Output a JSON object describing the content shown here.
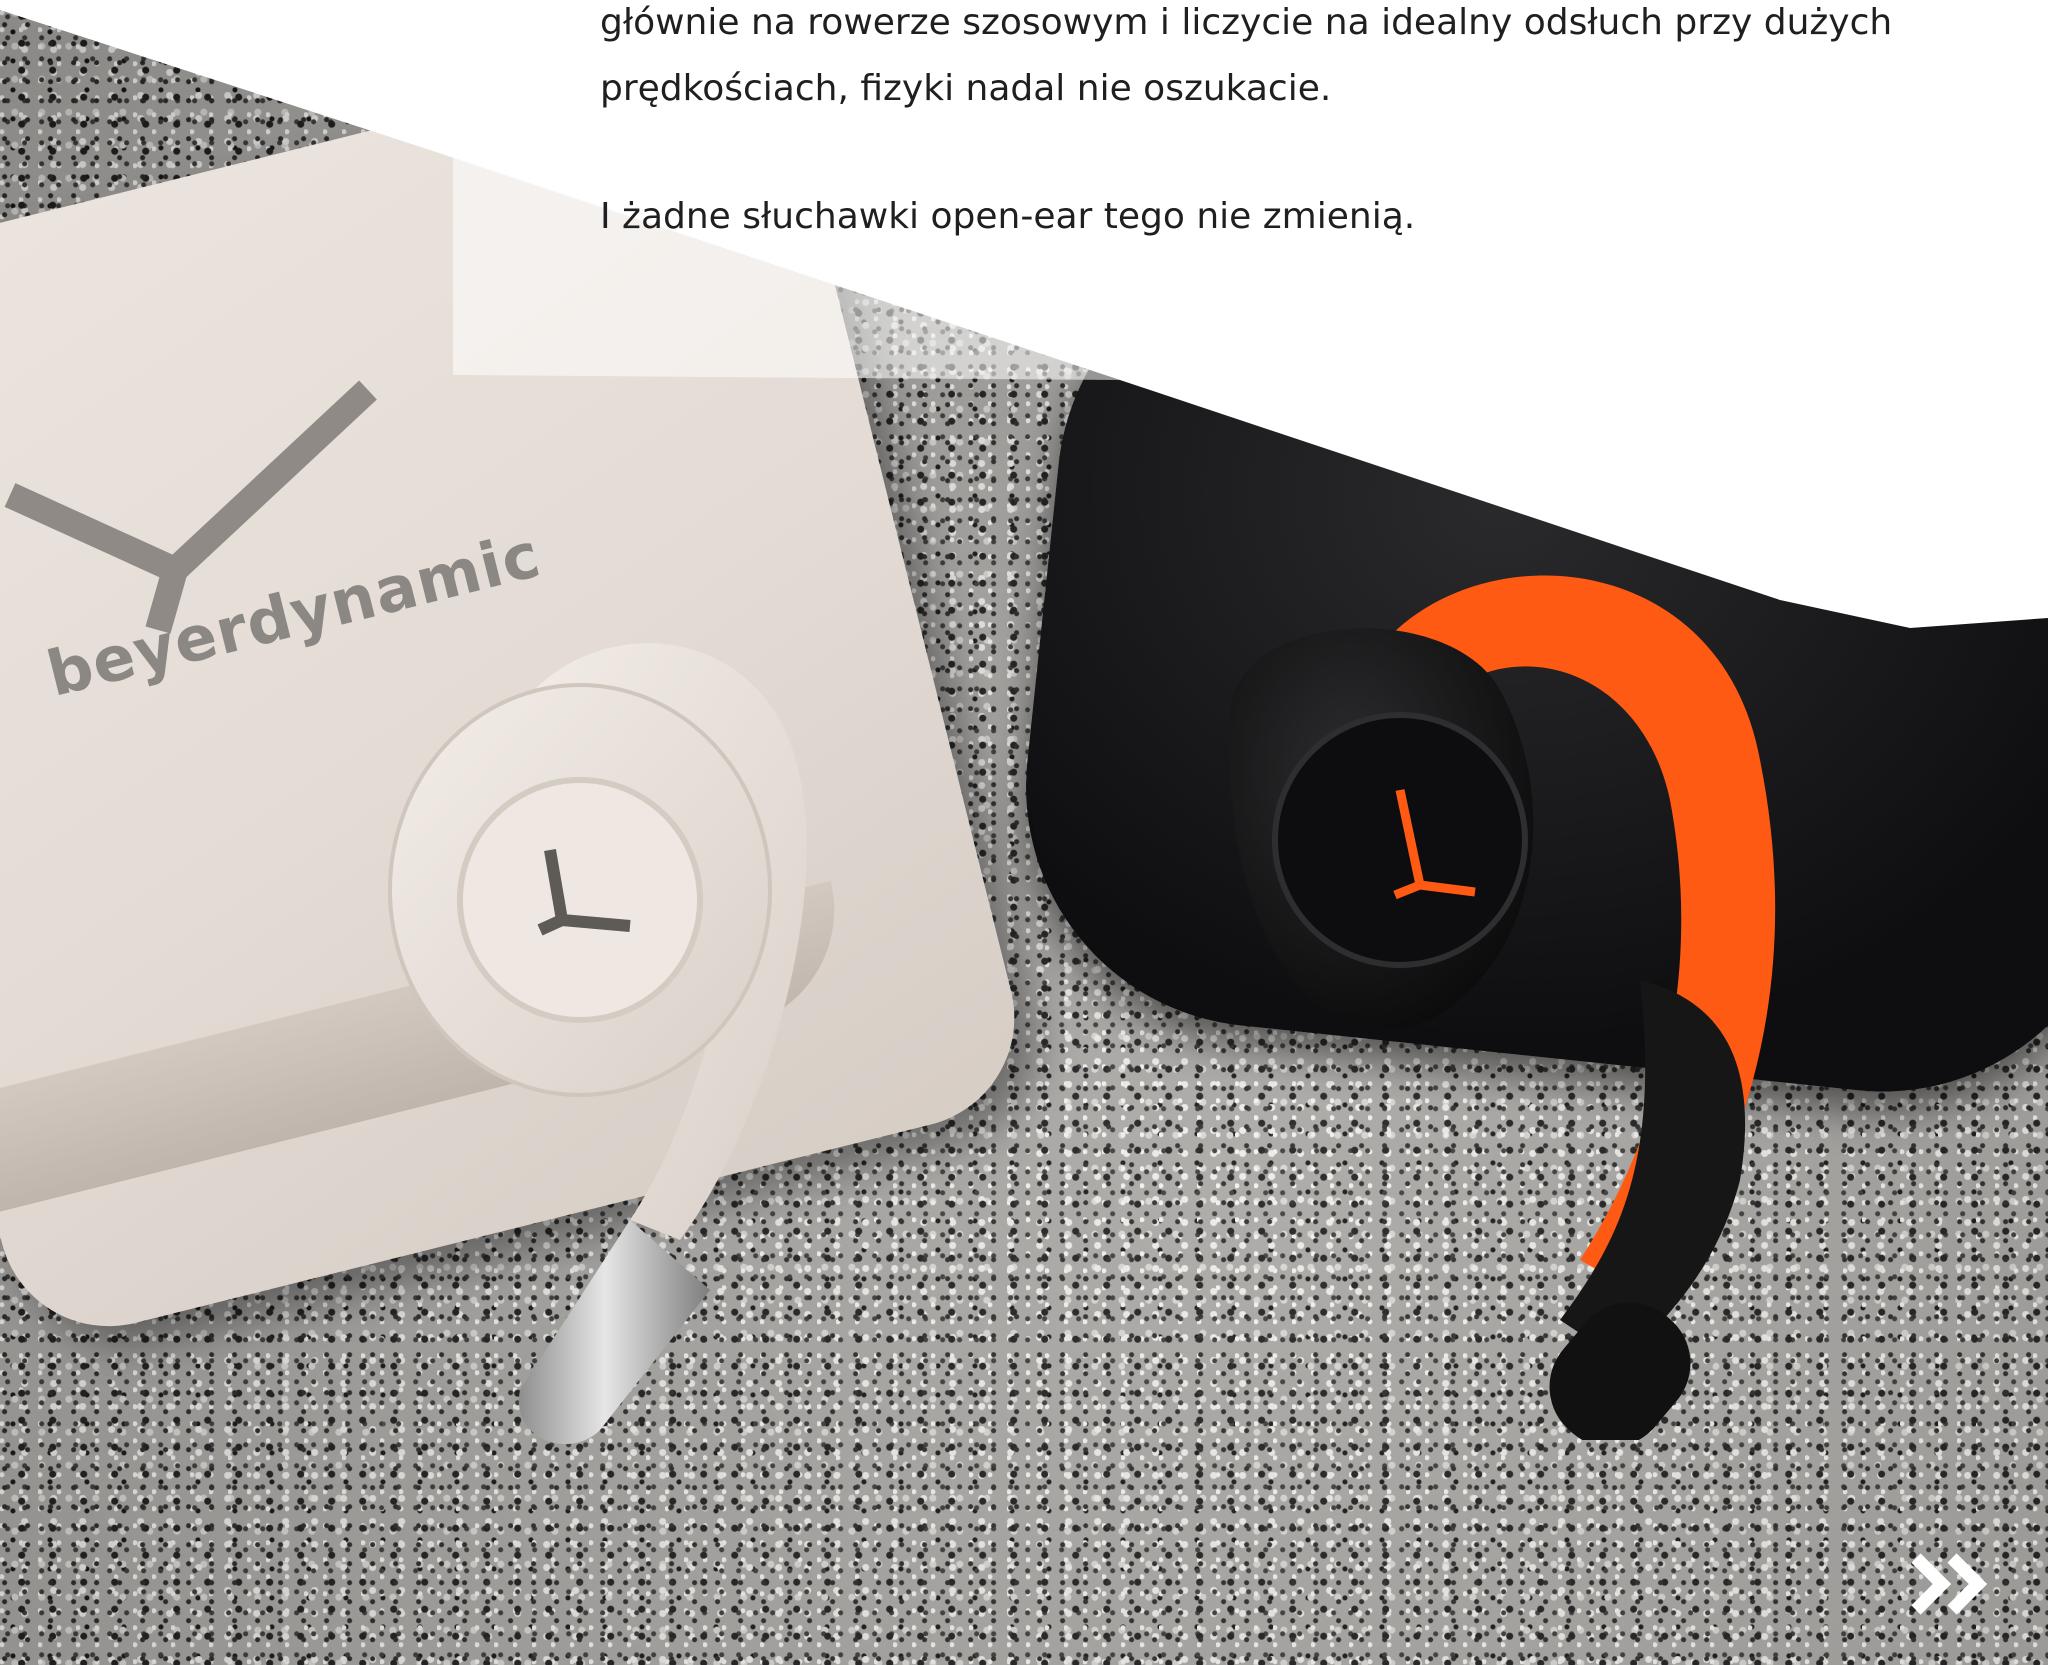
{
  "article": {
    "line1": "głównie na rowerze szosowym i liczycie na idealny odsłuch przy dużych",
    "line2": "prędkościach, fizyki nadal nie oszukacie.",
    "line3": "I żadne słuchawki open-ear tego nie zmienią."
  },
  "photo": {
    "brand_label": "beyerdynamic"
  },
  "navigation": {
    "next_icon": "double-chevron-right-icon"
  },
  "colors": {
    "accent_orange": "#ff5a14",
    "case_white": "#e6ded7",
    "case_black": "#141416",
    "text": "#1f1f1f"
  }
}
